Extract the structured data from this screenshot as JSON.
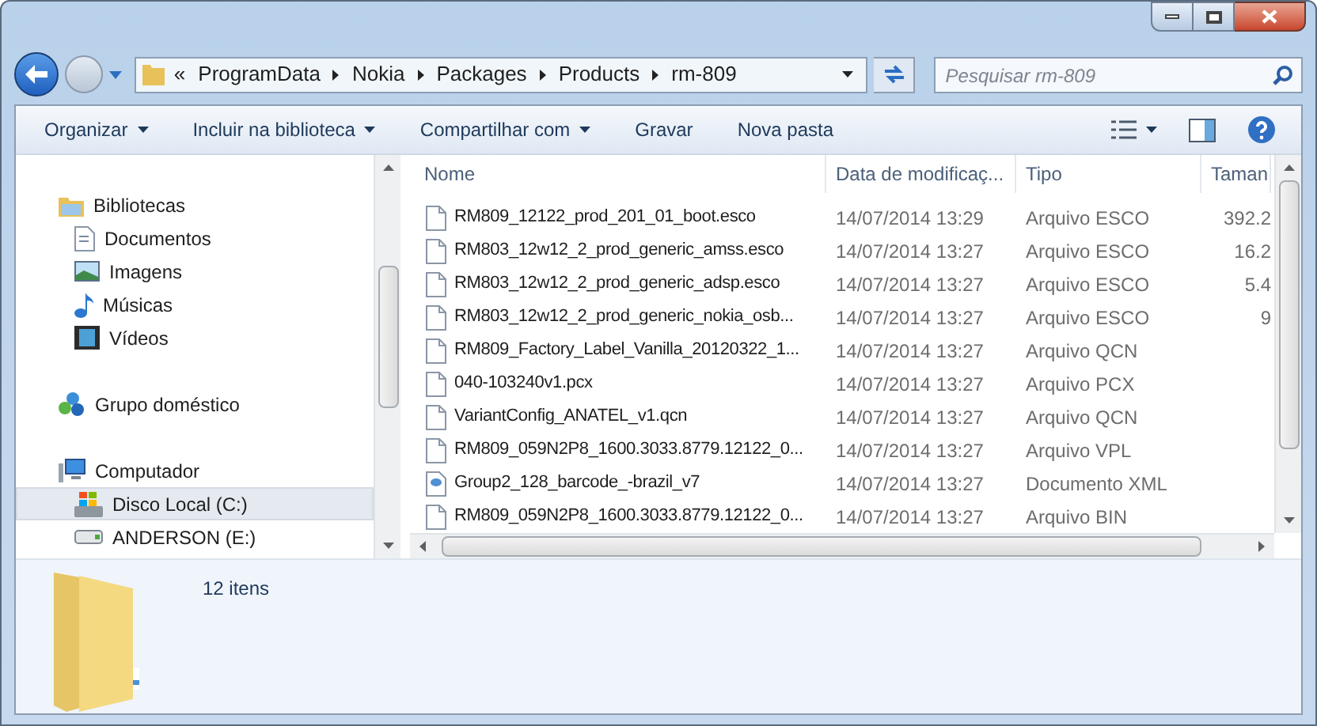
{
  "address": {
    "overflow": "«",
    "crumbs": [
      "ProgramData",
      "Nokia",
      "Packages",
      "Products",
      "rm-809"
    ]
  },
  "search": {
    "placeholder": "Pesquisar rm-809"
  },
  "toolbar": [
    {
      "label": "Organizar",
      "dropdown": true
    },
    {
      "label": "Incluir na biblioteca",
      "dropdown": true
    },
    {
      "label": "Compartilhar com",
      "dropdown": true
    },
    {
      "label": "Gravar",
      "dropdown": false
    },
    {
      "label": "Nova pasta",
      "dropdown": false
    }
  ],
  "sidebar": {
    "items": [
      {
        "label": "Bibliotecas",
        "kind": "library",
        "selected": false,
        "children": [
          {
            "label": "Documentos",
            "kind": "documents",
            "selected": false
          },
          {
            "label": "Imagens",
            "kind": "pictures",
            "selected": false
          },
          {
            "label": "Músicas",
            "kind": "music",
            "selected": false
          },
          {
            "label": "Vídeos",
            "kind": "videos",
            "selected": false
          }
        ]
      },
      {
        "label": "Grupo doméstico",
        "kind": "homegroup",
        "selected": false
      },
      {
        "label": "Computador",
        "kind": "computer",
        "selected": false,
        "children": [
          {
            "label": "Disco Local (C:)",
            "kind": "disk",
            "selected": true
          },
          {
            "label": "ANDERSON (E:)",
            "kind": "drive",
            "selected": false
          }
        ]
      }
    ]
  },
  "table": {
    "columns": [
      "Nome",
      "Data de modificaç...",
      "Tipo",
      "Taman"
    ],
    "rows": [
      {
        "kind": "file",
        "name": "RM809_12122_prod_201_01_boot.esco",
        "date": "14/07/2014 13:29",
        "type": "Arquivo ESCO",
        "size": "392.2"
      },
      {
        "kind": "file",
        "name": "RM803_12w12_2_prod_generic_amss.esco",
        "date": "14/07/2014 13:27",
        "type": "Arquivo ESCO",
        "size": "16.2"
      },
      {
        "kind": "file",
        "name": "RM803_12w12_2_prod_generic_adsp.esco",
        "date": "14/07/2014 13:27",
        "type": "Arquivo ESCO",
        "size": "5.4"
      },
      {
        "kind": "file",
        "name": "RM803_12w12_2_prod_generic_nokia_osb...",
        "date": "14/07/2014 13:27",
        "type": "Arquivo ESCO",
        "size": "9"
      },
      {
        "kind": "file",
        "name": "RM809_Factory_Label_Vanilla_20120322_1...",
        "date": "14/07/2014 13:27",
        "type": "Arquivo QCN"
      },
      {
        "kind": "file",
        "name": "040-103240v1.pcx",
        "date": "14/07/2014 13:27",
        "type": "Arquivo PCX"
      },
      {
        "kind": "file",
        "name": "VariantConfig_ANATEL_v1.qcn",
        "date": "14/07/2014 13:27",
        "type": "Arquivo QCN"
      },
      {
        "kind": "file",
        "name": "RM809_059N2P8_1600.3033.8779.12122_0...",
        "date": "14/07/2014 13:27",
        "type": "Arquivo VPL"
      },
      {
        "kind": "xml",
        "name": "Group2_128_barcode_-brazil_v7",
        "date": "14/07/2014 13:27",
        "type": "Documento XML"
      },
      {
        "kind": "file",
        "name": "RM809_059N2P8_1600.3033.8779.12122_0...",
        "date": "14/07/2014 13:27",
        "type": "Arquivo BIN"
      }
    ]
  },
  "details": {
    "count": "12 itens"
  }
}
